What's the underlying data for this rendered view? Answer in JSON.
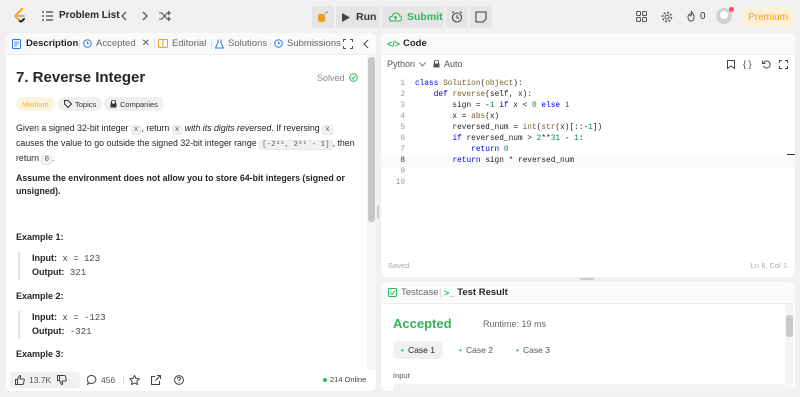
{
  "topbar": {
    "problem_list": "Problem List",
    "run": "Run",
    "submit": "Submit",
    "streak_count": "0",
    "premium": "Premium"
  },
  "left_tabs": {
    "description": "Description",
    "accepted": "Accepted",
    "editorial": "Editorial",
    "solutions": "Solutions",
    "submissions": "Submissions"
  },
  "problem": {
    "title": "7. Reverse Integer",
    "solved": "Solved",
    "difficulty": "Medium",
    "topics": "Topics",
    "companies": "Companies",
    "desc_part1": "Given a signed 32-bit integer ",
    "desc_x": "x",
    "desc_part2": ", return ",
    "desc_x2": "x",
    "desc_italic": " with its digits reversed",
    "desc_part3": ". If reversing ",
    "desc_x3": "x",
    "desc_part4": " causes the value to go outside the signed 32-bit integer range ",
    "desc_range": "[-2³¹, 2³¹ - 1]",
    "desc_part5": ", then return ",
    "desc_zero": "0",
    "desc_end": ".",
    "assumption": "Assume the environment does not allow you to store 64-bit integers (signed or unsigned).",
    "examples": [
      {
        "title": "Example 1:",
        "input_label": "Input:",
        "input": "x = 123",
        "output_label": "Output:",
        "output": "321"
      },
      {
        "title": "Example 2:",
        "input_label": "Input:",
        "input": "x = -123",
        "output_label": "Output:",
        "output": "-321"
      },
      {
        "title": "Example 3:"
      }
    ]
  },
  "bottom": {
    "likes": "13.7K",
    "comments": "456",
    "online": "214 Online"
  },
  "code_panel": {
    "title": "Code",
    "language": "Python",
    "mode": "Auto",
    "saved": "Saved",
    "cursor": "Ln 8, Col 1",
    "lines": [
      {
        "n": "1",
        "text": "class Solution(object):"
      },
      {
        "n": "2",
        "text": "    def reverse(self, x):"
      },
      {
        "n": "3",
        "text": "        sign = -1 if x < 0 else 1"
      },
      {
        "n": "4",
        "text": "        x = abs(x)"
      },
      {
        "n": "5",
        "text": "        reversed_num = int(str(x)[::-1])"
      },
      {
        "n": "6",
        "text": "        if reversed_num > 2**31 - 1:"
      },
      {
        "n": "7",
        "text": "            return 0"
      },
      {
        "n": "8",
        "text": "        return sign * reversed_num"
      },
      {
        "n": "9",
        "text": ""
      },
      {
        "n": "10",
        "text": ""
      }
    ]
  },
  "test_panel": {
    "testcase_tab": "Testcase",
    "result_tab": "Test Result",
    "status": "Accepted",
    "runtime": "Runtime: 19 ms",
    "cases": [
      "Case 1",
      "Case 2",
      "Case 3"
    ],
    "input_label": "Input"
  },
  "colors": {
    "accepted_green": "#2db55d",
    "medium_orange": "#ffb800",
    "premium_orange": "#f0a020"
  }
}
